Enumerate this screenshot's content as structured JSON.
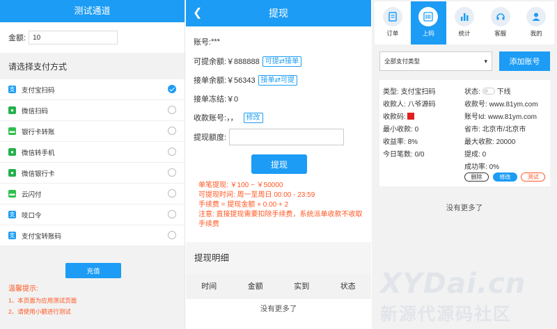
{
  "panel1": {
    "title": "测试通道",
    "amount_label": "金额:",
    "amount_value": "10",
    "pay_title": "请选择支付方式",
    "pay_methods": [
      {
        "label": "支付宝扫码",
        "icon": "alipay-icon",
        "color": "#1c9cf4",
        "selected": true
      },
      {
        "label": "微信扫码",
        "icon": "wechat-icon",
        "color": "#22b14c",
        "selected": false
      },
      {
        "label": "银行卡转账",
        "icon": "bankcard-icon",
        "color": "#2fbf4f",
        "selected": false
      },
      {
        "label": "微信转手机",
        "icon": "wechat-icon",
        "color": "#22b14c",
        "selected": false
      },
      {
        "label": "微信银行卡",
        "icon": "wechat-icon",
        "color": "#22b14c",
        "selected": false
      },
      {
        "label": "云闪付",
        "icon": "unionpay-icon",
        "color": "#2fbf4f",
        "selected": false
      },
      {
        "label": "吱口令",
        "icon": "alipay-icon",
        "color": "#1c9cf4",
        "selected": false
      },
      {
        "label": "支付宝转账码",
        "icon": "alipay-icon",
        "color": "#1c9cf4",
        "selected": false
      }
    ],
    "recharge_label": "充值",
    "tips_title": "温馨提示:",
    "tips": [
      "1、本页面为应用测试页面",
      "2、请使用小额进行测试"
    ]
  },
  "panel2": {
    "title": "提现",
    "account_label": "账号:",
    "account_value": "***",
    "withdrawable_label": "可提余额:",
    "withdrawable_value": "￥888888",
    "withdrawable_tag": "可提⇄接单",
    "order_balance_label": "接单余额:",
    "order_balance_value": "￥56343",
    "order_balance_tag": "接单⇄可提",
    "frozen_label": "接单冻结:",
    "frozen_value": "￥0",
    "receive_label": "收款账号:",
    "receive_value": "，，",
    "modify_label": "修改",
    "amount_label": "提现额度:",
    "submit_label": "提现",
    "notes": [
      "单笔提现: ￥100 ~ ￥50000",
      "可提现时间: 周一至周日 00:00 - 23:59",
      "手续费 = 提现金额 × 0.00 + 2",
      "注意: 直接提现需要扣除手续费，系统派单收款不收取手续费"
    ],
    "detail_title": "提现明细",
    "columns": [
      "时间",
      "金额",
      "实到",
      "状态"
    ],
    "empty_text": "没有更多了"
  },
  "panel3": {
    "tabs": [
      {
        "label": "订单",
        "icon": "order-icon",
        "active": false
      },
      {
        "label": "上码",
        "icon": "barcode-icon",
        "active": true
      },
      {
        "label": "统计",
        "icon": "chart-icon",
        "active": false
      },
      {
        "label": "客服",
        "icon": "headset-icon",
        "active": false
      },
      {
        "label": "我的",
        "icon": "user-icon",
        "active": false
      }
    ],
    "filter_value": "全部支付类型",
    "add_label": "添加账号",
    "card": {
      "type_label": "类型:",
      "type_value": "支付宝扫码",
      "status_label": "状态:",
      "status_value": "下线",
      "receiver_label": "收款人:",
      "receiver_value": "八爷源码",
      "receive_no_label": "收款号:",
      "receive_no_value": "www.81ym.com",
      "qr_label": "收款码:",
      "account_id_label": "账号Id:",
      "account_id_value": "www.81ym.com",
      "min_label": "最小收款:",
      "min_value": "0",
      "region_label": "省市:",
      "region_value": "北京市/北京市",
      "rate_label": "收益率:",
      "rate_value": "8%",
      "max_label": "最大收款:",
      "max_value": "20000",
      "today_label": "今日笔数:",
      "today_value": "0/0",
      "fee_label": "提成:",
      "fee_value": "0",
      "success_label": "成功率:",
      "success_value": "0%",
      "delete_label": "删除",
      "edit_label": "修改",
      "test_label": "测试"
    },
    "empty_text": "没有更多了",
    "watermark": "XYDai.cn",
    "watermark_sub": "新源代源码社区"
  }
}
